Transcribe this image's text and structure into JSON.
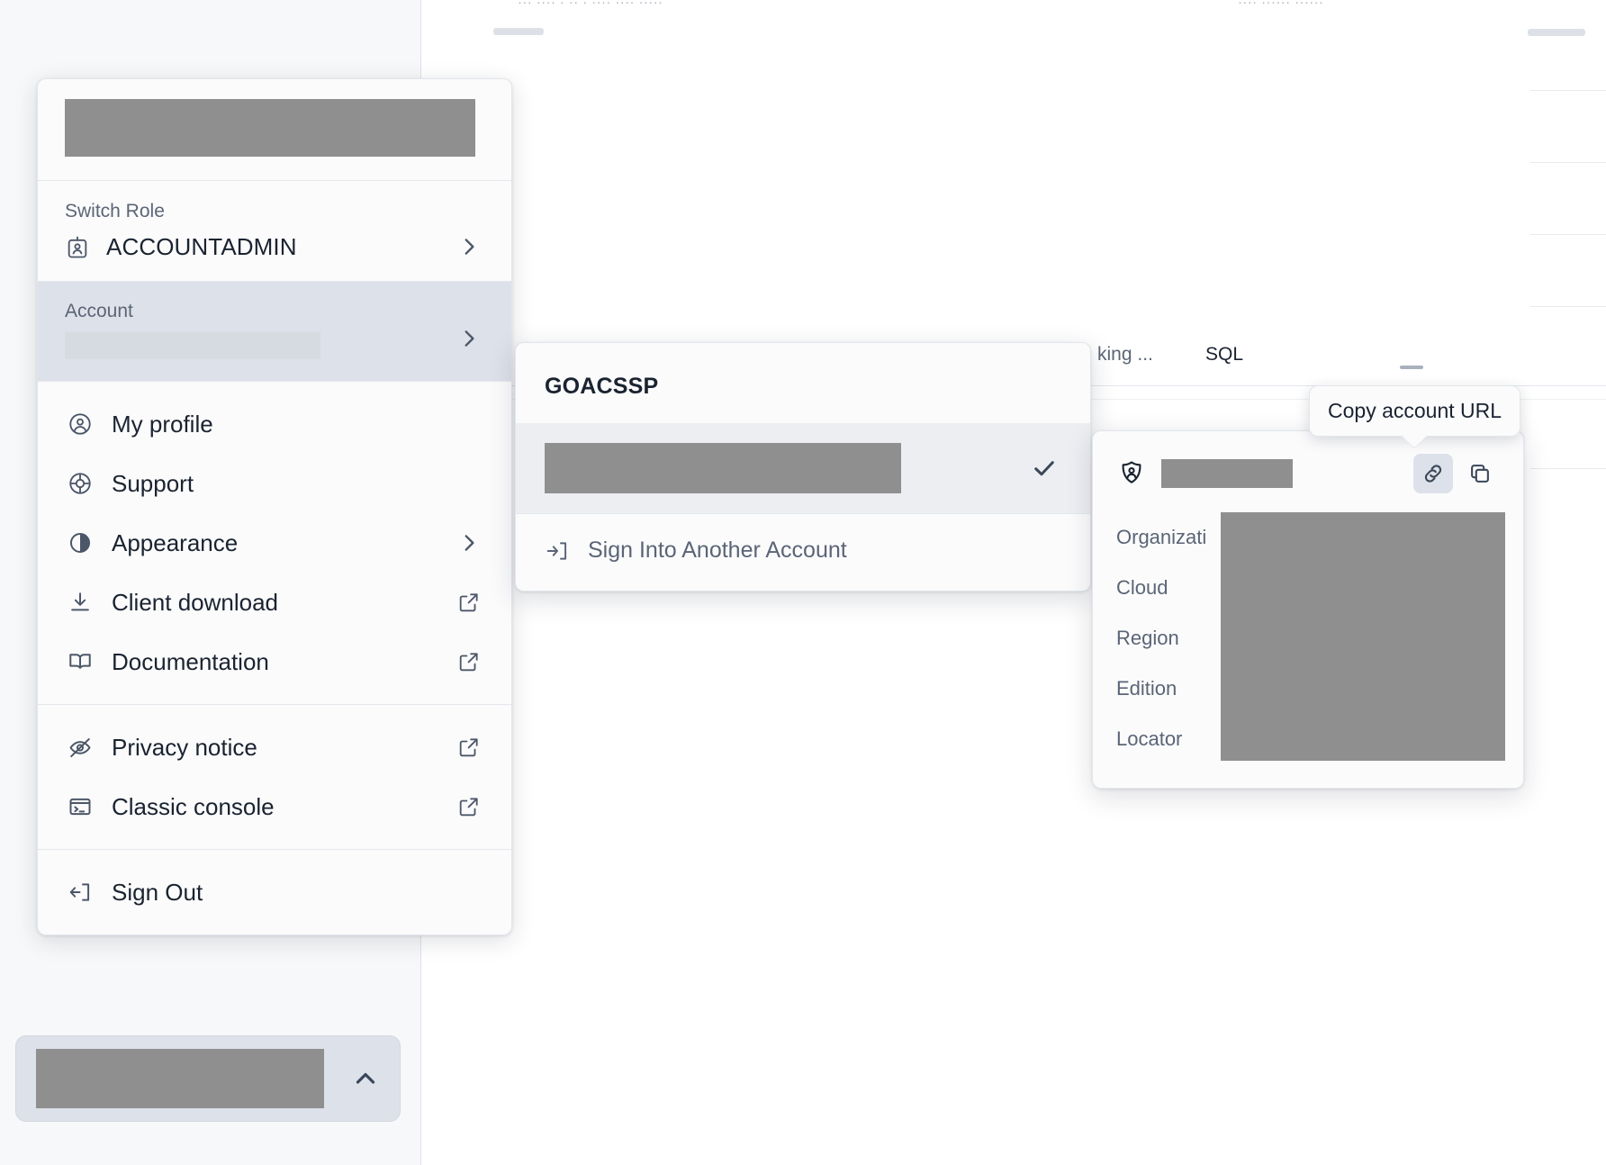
{
  "background": {
    "top_text_left": "··· ···· · ·· · ···· ···· ·····",
    "top_text_right": "····   ······ ······",
    "sidebar_region": "app-sidebar",
    "main_region": "app-main-content"
  },
  "workspace_header": {
    "tabs": [
      {
        "label": "king ...",
        "name": "tab-truncated"
      },
      {
        "label": "SQL",
        "name": "tab-sql"
      }
    ],
    "minimize_label": "—"
  },
  "account_menu": {
    "identity": {
      "redacted": true,
      "placeholder": "user identity"
    },
    "switch_role": {
      "label": "Switch Role",
      "role_icon": "id-badge-icon",
      "role": "ACCOUNTADMIN",
      "chevron": "chevron-right-icon"
    },
    "account": {
      "label": "Account",
      "value_redacted": true,
      "chevron": "chevron-right-icon"
    },
    "items": [
      {
        "label": "My profile",
        "icon": "user-circle-icon",
        "external": false,
        "name": "menu-item-my-profile"
      },
      {
        "label": "Support",
        "icon": "lifebuoy-icon",
        "external": false,
        "name": "menu-item-support"
      },
      {
        "label": "Appearance",
        "icon": "half-circle-icon",
        "external": false,
        "chevron": true,
        "name": "menu-item-appearance"
      },
      {
        "label": "Client download",
        "icon": "download-icon",
        "external": true,
        "name": "menu-item-client-download"
      },
      {
        "label": "Documentation",
        "icon": "book-open-icon",
        "external": true,
        "name": "menu-item-documentation"
      }
    ],
    "items_secondary": [
      {
        "label": "Privacy notice",
        "icon": "eye-off-icon",
        "external": true,
        "name": "menu-item-privacy-notice"
      },
      {
        "label": "Classic console",
        "icon": "terminal-icon",
        "external": true,
        "name": "menu-item-classic-console"
      }
    ],
    "sign_out": {
      "label": "Sign Out",
      "icon": "sign-out-icon",
      "name": "menu-item-sign-out"
    }
  },
  "account_submenu": {
    "title": "GOACSSP",
    "selected_account": {
      "redacted": true,
      "check_icon": "check-icon"
    },
    "sign_into_another": {
      "label": "Sign Into Another Account",
      "icon": "sign-in-icon"
    }
  },
  "account_details": {
    "header": {
      "icon": "shield-user-icon",
      "name_redacted": true
    },
    "actions": [
      {
        "name": "copy-account-url-button",
        "icon": "link-icon",
        "active": true,
        "tooltip": "Copy account URL"
      },
      {
        "name": "copy-account-identifier-button",
        "icon": "copy-icon",
        "active": false
      }
    ],
    "rows": [
      {
        "key": "Organizati",
        "key_full": "Organization",
        "value_redacted": true
      },
      {
        "key": "Cloud",
        "key_full": "Cloud",
        "value_redacted": true
      },
      {
        "key": "Region",
        "key_full": "Region",
        "value_redacted": true
      },
      {
        "key": "Edition",
        "key_full": "Edition",
        "value_redacted": true
      },
      {
        "key": "Locator",
        "key_full": "Locator",
        "value_redacted": true
      }
    ]
  },
  "tooltip": {
    "text": "Copy account URL"
  },
  "user_button": {
    "label_redacted": true,
    "chevron": "chevron-up-icon"
  },
  "colors": {
    "panel_bg": "#fbfbfc",
    "panel_border": "#e2e6ea",
    "highlight_bg": "#dde1e9",
    "submenu_row_bg": "#eceef2",
    "text_primary": "#1a2330",
    "text_secondary": "#5b6576",
    "redaction": "#8f8f8f",
    "sidebar_bg": "#f7f8f9"
  }
}
